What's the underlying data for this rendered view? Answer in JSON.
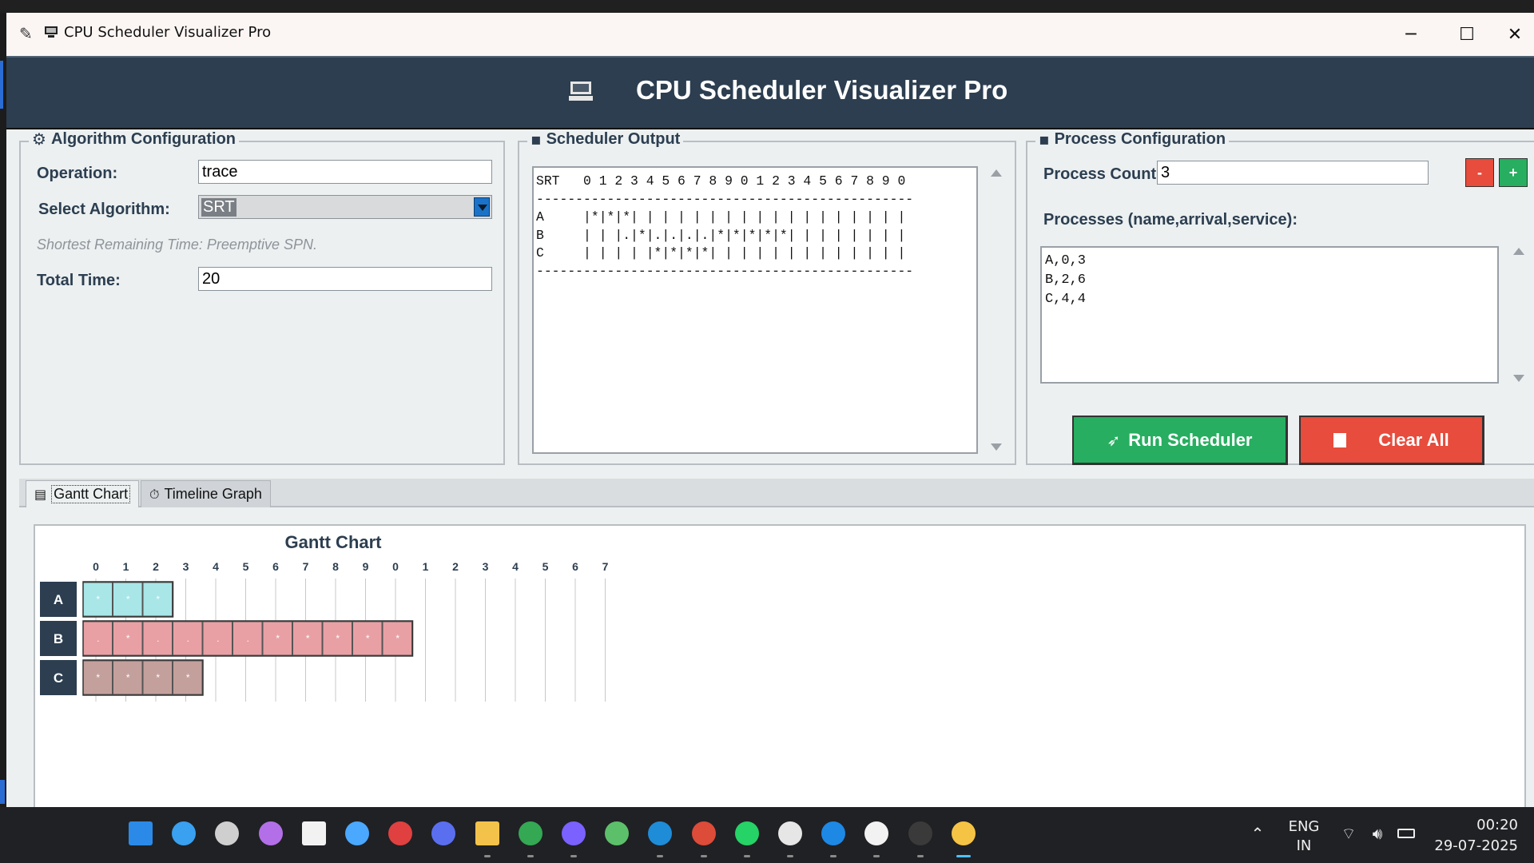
{
  "window": {
    "title": "CPU Scheduler Visualizer Pro",
    "header_title": "CPU Scheduler Visualizer Pro",
    "min_glyph": "─",
    "max_glyph": "☐",
    "close_glyph": "✕"
  },
  "algorithm_config": {
    "title": "Algorithm Configuration",
    "operation_label": "Operation:",
    "operation_value": "trace",
    "algorithm_label": "Select Algorithm:",
    "algorithm_value": "SRT",
    "algorithm_hint": "Shortest Remaining Time: Preemptive SPN.",
    "total_time_label": "Total Time:",
    "total_time_value": "20"
  },
  "scheduler_output": {
    "title": "Scheduler Output",
    "text": "SRT   0 1 2 3 4 5 6 7 8 9 0 1 2 3 4 5 6 7 8 9 0\n------------------------------------------------\nA     |*|*|*| | | | | | | | | | | | | | | | | |\nB     | | |.|*|.|.|.|.|*|*|*|*|*| | | | | | | |\nC     | | | | |*|*|*|*| | | | | | | | | | | | |\n------------------------------------------------"
  },
  "process_config": {
    "title": "Process Configuration",
    "count_label": "Process Count:",
    "count_value": "3",
    "minus_label": "-",
    "plus_label": "+",
    "processes_label": "Processes (name,arrival,service):",
    "processes_text": "A,0,3\nB,2,6\nC,4,4",
    "run_label": "Run Scheduler",
    "clear_label": "Clear All"
  },
  "tabs": {
    "gantt": "Gantt Chart",
    "timeline": "Timeline Graph"
  },
  "colors": {
    "header_bg": "#2c3e50",
    "run_button": "#27ae60",
    "clear_button": "#e74c3c",
    "process_A": "#a8e6e8",
    "process_B": "#e8a0a4",
    "process_C": "#c4a09c",
    "row_label_bg": "#2c3e50"
  },
  "chart_data": {
    "type": "gantt",
    "title": "Gantt Chart",
    "ticks": [
      "0",
      "1",
      "2",
      "3",
      "4",
      "5",
      "6",
      "7",
      "8",
      "9",
      "0",
      "1",
      "2",
      "3",
      "4",
      "5",
      "6",
      "7"
    ],
    "rows": [
      {
        "name": "A",
        "cells": [
          "*",
          "*",
          "*"
        ],
        "start": 0
      },
      {
        "name": "B",
        "cells": [
          ".",
          "*",
          ".",
          ".",
          ".",
          ".",
          "*",
          "*",
          "*",
          "*",
          "*"
        ],
        "start": 0
      },
      {
        "name": "C",
        "cells": [
          "*",
          "*",
          "*",
          "*"
        ],
        "start": 0
      }
    ]
  },
  "taskbar": {
    "lang": "ENG",
    "region": "IN",
    "time": "00:20",
    "date": "29-07-2025",
    "apps": [
      "windows-start",
      "search",
      "task-view",
      "copilot",
      "microsoft-store",
      "help",
      "mathworks",
      "visual-studio",
      "file-explorer",
      "maps",
      "gemini",
      "people",
      "edge",
      "chrome",
      "whatsapp",
      "chatgpt",
      "vscode",
      "font-app",
      "terminal",
      "python"
    ]
  }
}
